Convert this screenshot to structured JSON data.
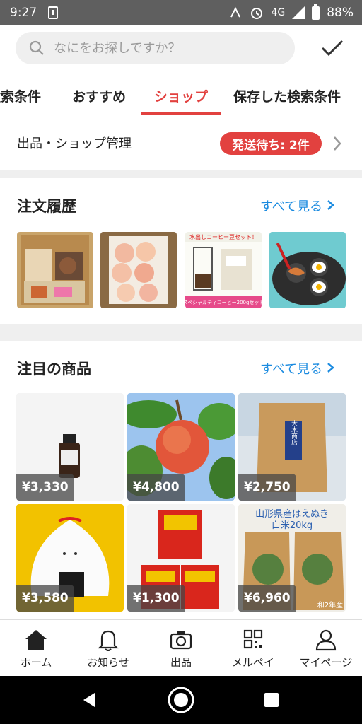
{
  "status_bar": {
    "time": "9:27",
    "network": "4G",
    "battery": "88%"
  },
  "search": {
    "placeholder": "なにをお探しですか？"
  },
  "tabs": [
    {
      "label": "検索条件"
    },
    {
      "label": "おすすめ"
    },
    {
      "label": "ショップ",
      "active": true
    },
    {
      "label": "保存した検索条件"
    }
  ],
  "manage": {
    "label": "出品・ショップ管理",
    "badge": "発送待ち: 2件"
  },
  "orders": {
    "title": "注文履歴",
    "see_all": "すべて見る",
    "items": [
      {
        "image": "assorted-snacks"
      },
      {
        "image": "peaches-box"
      },
      {
        "image": "cold-brew-coffee-set",
        "caption_top": "水出しコーヒー豆セット！",
        "caption_bottom": "スペシャルティコーヒー200gセット"
      },
      {
        "image": "egg-pan"
      }
    ]
  },
  "featured": {
    "title": "注目の商品",
    "see_all": "すべて見る",
    "items": [
      {
        "price": "¥3,330",
        "image": "essential-oil-bottle"
      },
      {
        "price": "¥4,800",
        "image": "peach-on-tree"
      },
      {
        "price": "¥2,750",
        "image": "rice-sack",
        "sack_label": "大木商店"
      },
      {
        "price": "¥3,580",
        "image": "onigiri-pouch"
      },
      {
        "price": "¥1,300",
        "image": "snack-boxes"
      },
      {
        "price": "¥6,960",
        "image": "rice-bags",
        "caption": "山形県産はえぬき\n白米20kg",
        "footnote": "和2年産"
      }
    ]
  },
  "bottom_nav": [
    {
      "label": "ホーム",
      "icon": "home-icon"
    },
    {
      "label": "お知らせ",
      "icon": "bell-icon"
    },
    {
      "label": "出品",
      "icon": "camera-icon"
    },
    {
      "label": "メルペイ",
      "icon": "qr-code-icon"
    },
    {
      "label": "マイページ",
      "icon": "person-icon"
    }
  ],
  "colors": {
    "accent": "#e2413f",
    "link": "#1b8be0"
  }
}
